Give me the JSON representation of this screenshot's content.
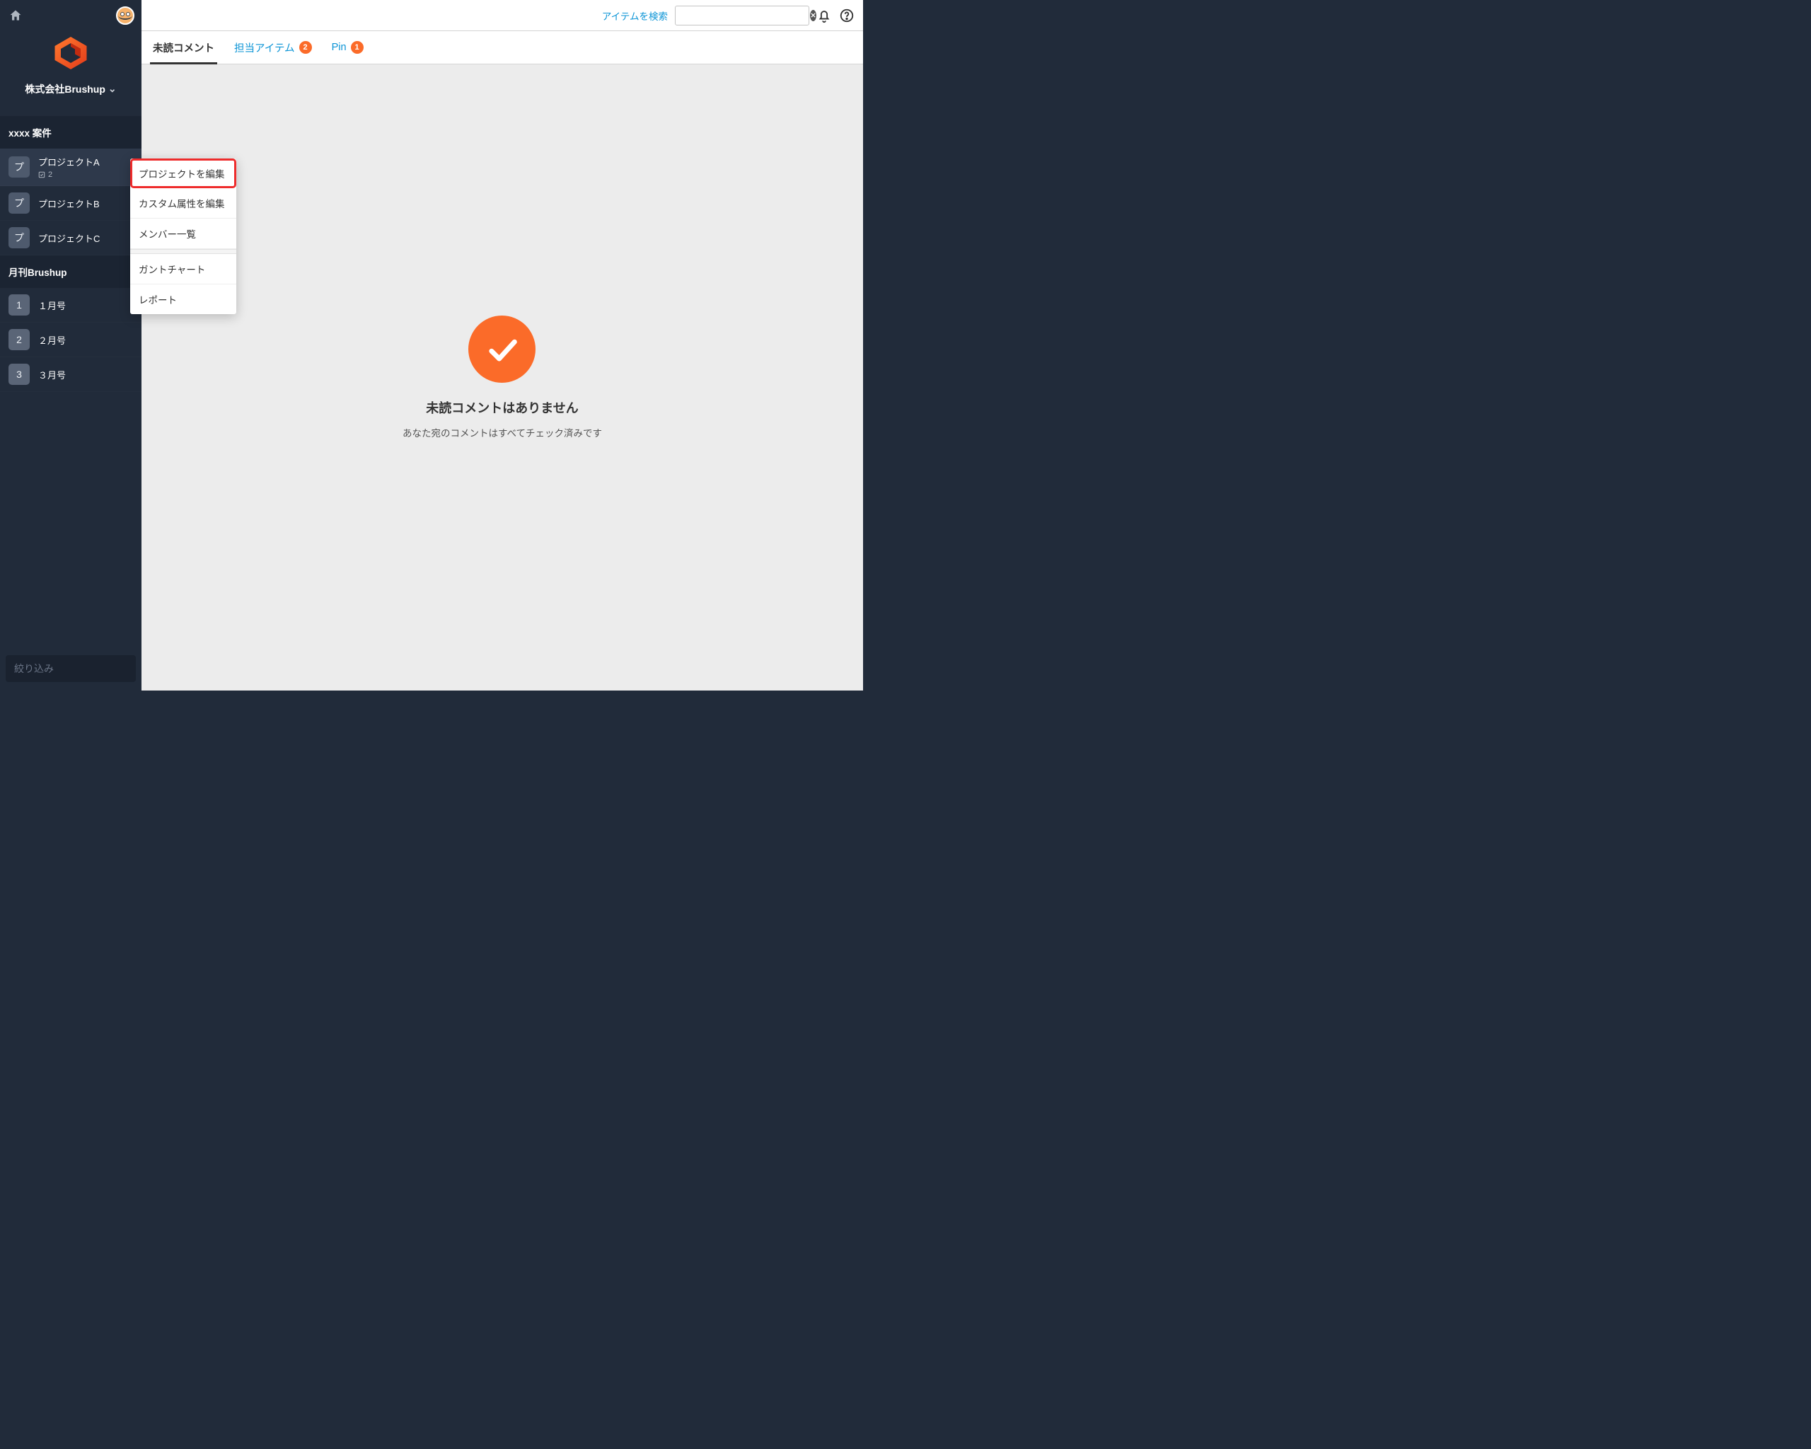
{
  "header": {
    "search_link_label": "アイテムを検索",
    "search_value": "",
    "search_placeholder": ""
  },
  "org": {
    "name": "株式会社Brushup"
  },
  "sidebar": {
    "filter_placeholder": "絞り込み",
    "groups": [
      {
        "title": "xxxx 案件",
        "items": [
          {
            "badge": "プ",
            "name": "プロジェクトA",
            "sub_count": "2",
            "active": true
          },
          {
            "badge": "プ",
            "name": "プロジェクトB"
          },
          {
            "badge": "プ",
            "name": "プロジェクトC"
          }
        ]
      },
      {
        "title": "月刊Brushup",
        "items": [
          {
            "badge": "1",
            "name": "１月号"
          },
          {
            "badge": "2",
            "name": "２月号"
          },
          {
            "badge": "3",
            "name": "３月号"
          }
        ]
      }
    ]
  },
  "tabs": {
    "unread_label": "未読コメント",
    "assigned_label": "担当アイテム",
    "assigned_count": "2",
    "pin_label": "Pin",
    "pin_count": "1"
  },
  "context_menu": {
    "edit_project": "プロジェクトを編集",
    "edit_custom_attrs": "カスタム属性を編集",
    "members": "メンバー一覧",
    "gantt": "ガントチャート",
    "report": "レポート"
  },
  "empty": {
    "title": "未読コメントはありません",
    "subtitle": "あなた宛のコメントはすべてチェック済みです"
  }
}
